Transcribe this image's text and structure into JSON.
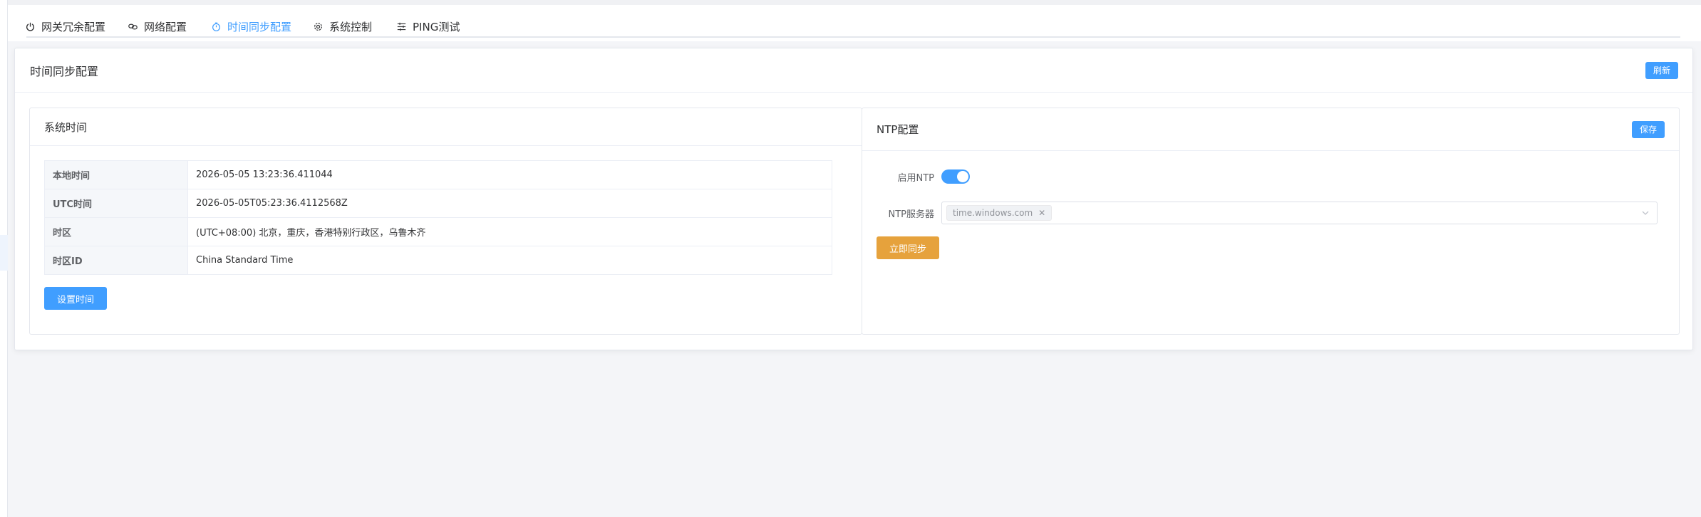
{
  "tabs": [
    {
      "label": "网关冗余配置",
      "icon": "power-icon"
    },
    {
      "label": "网络配置",
      "icon": "link-icon"
    },
    {
      "label": "时间同步配置",
      "icon": "timer-icon",
      "active": true
    },
    {
      "label": "系统控制",
      "icon": "gear-icon"
    },
    {
      "label": "PING测试",
      "icon": "sliders-icon"
    }
  ],
  "page": {
    "title": "时间同步配置",
    "refresh_label": "刷新"
  },
  "system_time": {
    "title": "系统时间",
    "rows": [
      {
        "label": "本地时间",
        "value": "2026-05-05 13:23:36.411044"
      },
      {
        "label": "UTC时间",
        "value": "2026-05-05T05:23:36.4112568Z"
      },
      {
        "label": "时区",
        "value": "(UTC+08:00) 北京，重庆，香港特别行政区，乌鲁木齐"
      },
      {
        "label": "时区ID",
        "value": "China Standard Time"
      }
    ],
    "set_time_label": "设置时间"
  },
  "ntp": {
    "title": "NTP配置",
    "save_label": "保存",
    "enable_label": "启用NTP",
    "enabled": true,
    "server_label": "NTP服务器",
    "servers": [
      "time.windows.com"
    ],
    "sync_label": "立即同步"
  },
  "colors": {
    "primary": "#409eff",
    "warning": "#e6a23c",
    "background": "#f4f5f8"
  }
}
